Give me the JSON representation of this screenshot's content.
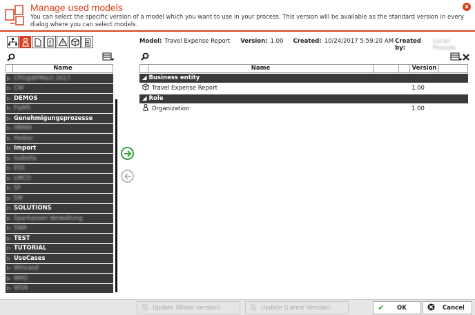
{
  "dialog": {
    "title": "Manage used models",
    "description": "You can select the specific version of a model which you want to use in your process. This version will be available as the standard version in every dialog where you can select models.",
    "close_label": "x"
  },
  "left_panel": {
    "tabs": [
      "hierarchy-icon",
      "person-icon",
      "document-icon",
      "sort-icon",
      "warning-icon",
      "cube-icon",
      "list-icon"
    ],
    "column_header": "Name",
    "items": [
      {
        "label": "CPO@BPM&O 2017",
        "blurred": true
      },
      {
        "label": "CW",
        "blurred": true
      },
      {
        "label": "DEMOS",
        "blurred": false
      },
      {
        "label": "F&MS",
        "blurred": true
      },
      {
        "label": "Genehmigungsprozesse",
        "blurred": false
      },
      {
        "label": "HRMH",
        "blurred": true
      },
      {
        "label": "Heiber",
        "blurred": true
      },
      {
        "label": "Import",
        "blurred": false
      },
      {
        "label": "Isabella",
        "blurred": true
      },
      {
        "label": "ESS",
        "blurred": true
      },
      {
        "label": "LMCO",
        "blurred": true
      },
      {
        "label": "SF",
        "blurred": true
      },
      {
        "label": "SM",
        "blurred": true
      },
      {
        "label": "SOLUTIONS",
        "blurred": false
      },
      {
        "label": "Sparkassen Verwaltung",
        "blurred": true
      },
      {
        "label": "SWA",
        "blurred": true
      },
      {
        "label": "TEST",
        "blurred": false
      },
      {
        "label": "TUTORIAL",
        "blurred": false
      },
      {
        "label": "UseCases",
        "blurred": false
      },
      {
        "label": "Wincasd",
        "blurred": true
      },
      {
        "label": "WKO",
        "blurred": true
      },
      {
        "label": "WSN",
        "blurred": true
      }
    ]
  },
  "model_info": {
    "model_label": "Model:",
    "model_value": "Travel Expense Report",
    "version_label": "Version:",
    "version_value": "1.00",
    "created_label": "Created:",
    "created_value": "10/24/2017 5:59:20 AM",
    "created_by_label": "Created by:",
    "created_by_value": "Lucas Pinsoda"
  },
  "grid": {
    "header_name": "Name",
    "header_version": "Version",
    "groups": [
      {
        "label": "Business entity",
        "rows": [
          {
            "icon": "cube-icon",
            "name": "Travel Expense Report",
            "version": "1.00"
          }
        ]
      },
      {
        "label": "Role",
        "rows": [
          {
            "icon": "person-icon",
            "name": "Organization",
            "version": "1.00"
          }
        ]
      }
    ]
  },
  "footer": {
    "update_minor": "Update (Minor Version)",
    "update_latest": "Update (Latest Version)",
    "ok": "OK",
    "cancel": "Cancel"
  },
  "colors": {
    "accent": "#d9411e",
    "row_dark": "#3a3a3a",
    "ok_green": "#3aa13a"
  }
}
